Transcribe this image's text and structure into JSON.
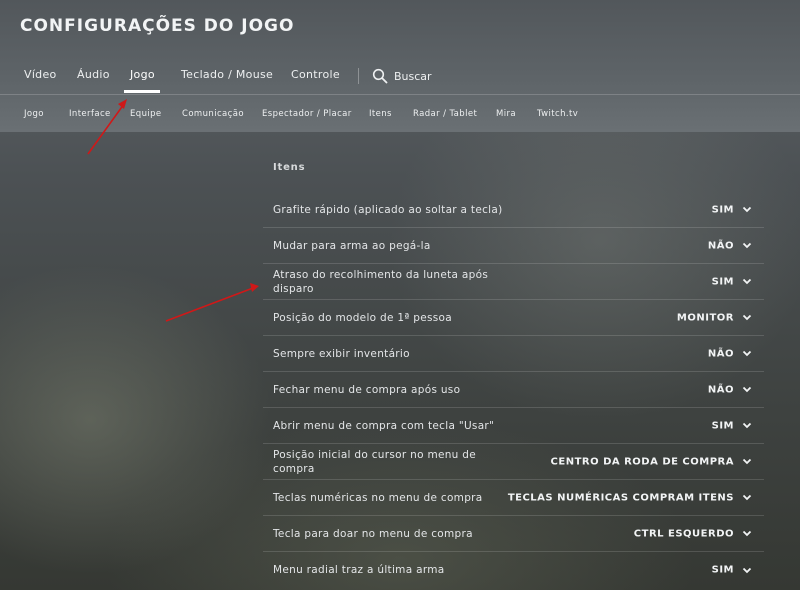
{
  "header": {
    "title": "CONFIGURAÇÕES DO JOGO"
  },
  "main_tabs": [
    {
      "label": "Vídeo"
    },
    {
      "label": "Áudio"
    },
    {
      "label": "Jogo"
    },
    {
      "label": "Teclado / Mouse"
    },
    {
      "label": "Controle"
    }
  ],
  "search": {
    "label": "Buscar"
  },
  "sub_tabs": [
    {
      "label": "Jogo"
    },
    {
      "label": "Interface"
    },
    {
      "label": "Equipe"
    },
    {
      "label": "Comunicação"
    },
    {
      "label": "Espectador / Placar"
    },
    {
      "label": "Itens"
    },
    {
      "label": "Radar / Tablet"
    },
    {
      "label": "Mira"
    },
    {
      "label": "Twitch.tv"
    }
  ],
  "section": {
    "title": "Itens"
  },
  "settings": [
    {
      "label": "Grafite rápido (aplicado ao soltar a tecla)",
      "value": "SIM"
    },
    {
      "label": "Mudar para arma ao pegá-la",
      "value": "NÃO"
    },
    {
      "label": "Atraso do recolhimento da luneta após disparo",
      "value": "SIM"
    },
    {
      "label": "Posição do modelo de 1ª pessoa",
      "value": "MONITOR"
    },
    {
      "label": "Sempre exibir inventário",
      "value": "NÃO"
    },
    {
      "label": "Fechar menu de compra após uso",
      "value": "NÃO"
    },
    {
      "label": "Abrir menu de compra com tecla \"Usar\"",
      "value": "SIM"
    },
    {
      "label": "Posição inicial do cursor no menu de compra",
      "value": "CENTRO DA RODA DE COMPRA"
    },
    {
      "label": "Teclas numéricas no menu de compra",
      "value": "TECLAS NUMÉRICAS COMPRAM ITENS"
    },
    {
      "label": "Tecla para doar no menu de compra",
      "value": "CTRL ESQUERDO"
    },
    {
      "label": "Menu radial traz a última arma",
      "value": "SIM"
    }
  ],
  "colors": {
    "annotation_arrow": "#d01818",
    "accent": "#ffffff"
  }
}
